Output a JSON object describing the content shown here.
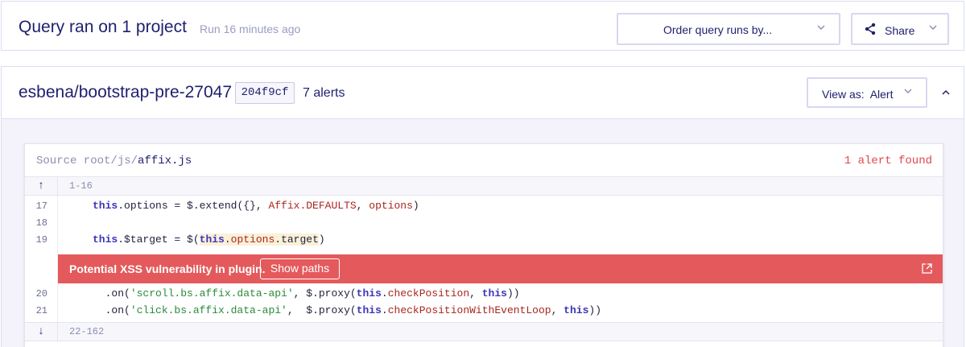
{
  "header": {
    "title": "Query ran on 1 project",
    "run_time": "Run 16 minutes ago",
    "order_button": "Order query runs by...",
    "share_button": "Share"
  },
  "project": {
    "name": "esbena/bootstrap-pre-27047",
    "commit": "204f9cf",
    "alert_count": "7 alerts",
    "view_as_label": "View as:",
    "view_as_value": "Alert"
  },
  "source": {
    "prefix": "Source root/js/",
    "file": "affix.js",
    "alerts_found": "1 alert found",
    "range_top": "1-16",
    "range_bottom": "22-162",
    "arrow_up": "↑",
    "arrow_down": "↓",
    "line_numbers": [
      "17",
      "18",
      "19",
      "20",
      "21"
    ]
  },
  "alert": {
    "message": "Potential XSS vulnerability in plugin.",
    "show_paths": "Show paths"
  },
  "colors": {
    "accent": "#1e1f6e",
    "alert": "#e45a5c",
    "panel_bg": "#f4f3fc"
  }
}
